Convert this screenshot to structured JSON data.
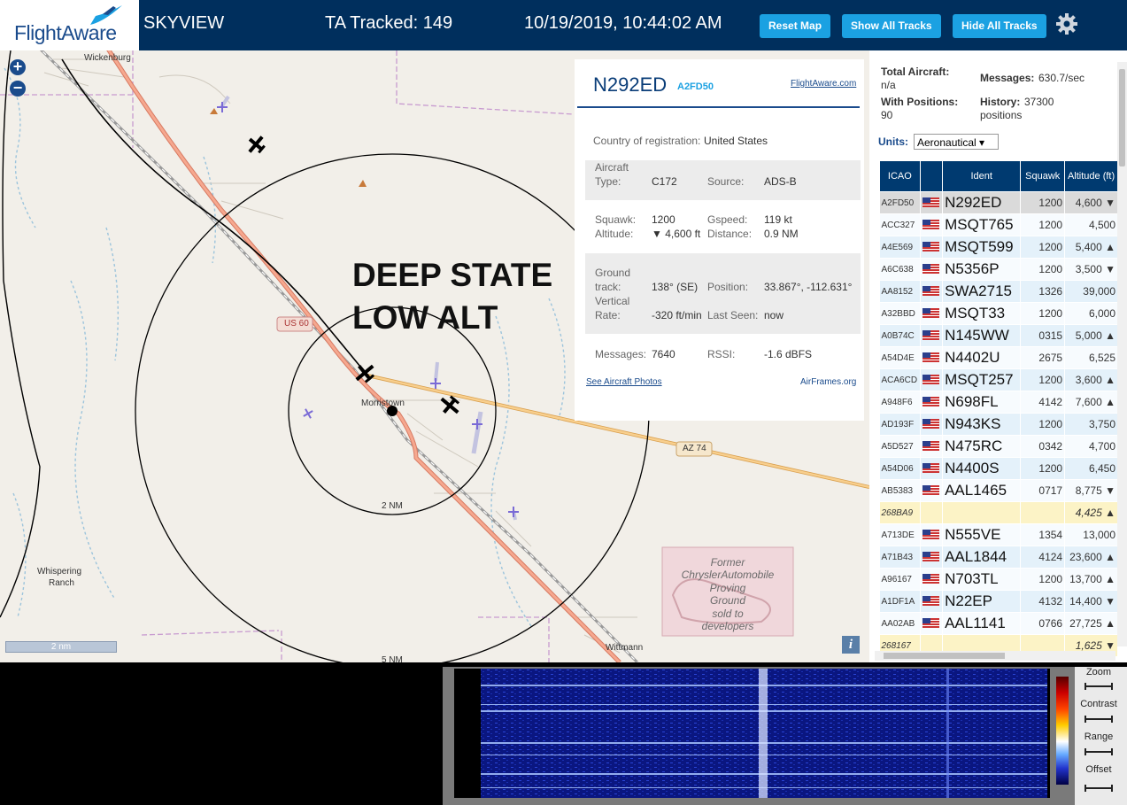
{
  "header": {
    "logo_text": "FlightAware",
    "title": "SKYVIEW",
    "tracked": "TA Tracked: 149",
    "datetime": "10/19/2019, 10:44:02 AM",
    "buttons": {
      "reset": "Reset Map",
      "show_all": "Show All Tracks",
      "hide_all": "Hide All Tracks"
    },
    "colors": {
      "bar": "#002f5d",
      "button": "#1ba1e2"
    }
  },
  "map": {
    "zoom_in": "+",
    "zoom_out": "−",
    "scale": "2 nm",
    "info": "i",
    "labels": {
      "wickenburg": "Wickenburg",
      "us60": "US 60",
      "az74": "AZ 74",
      "morristown": "Morristown",
      "ring_2nm": "2 NM",
      "ring_5nm": "5 NM",
      "whispering_1": "Whispering",
      "whispering_2": "Ranch",
      "wittmann": "Wittmann",
      "former": [
        "Former",
        "ChryslerAutomobile",
        "Proving",
        "Ground",
        "sold to",
        "developers"
      ]
    },
    "annotation": [
      "DEEP STATE",
      "LOW ALT"
    ]
  },
  "detail": {
    "callsign": "N292ED",
    "hex": "A2FD50",
    "fa_link": "FlightAware.com",
    "country_label": "Country of registration:",
    "country": "United States",
    "aircraft_type_label": [
      "Aircraft",
      "Type:"
    ],
    "aircraft_type": "C172",
    "source_label": "Source:",
    "source": "ADS-B",
    "squawk_label": "Squawk:",
    "squawk": "1200",
    "gspeed_label": "Gspeed:",
    "gspeed": "119 kt",
    "altitude_label": "Altitude:",
    "altitude": "▼ 4,600 ft",
    "distance_label": "Distance:",
    "distance": "0.9 NM",
    "ground_label": [
      "Ground",
      "track:"
    ],
    "ground": "138° (SE)",
    "position_label": "Position:",
    "position": "33.867°, -112.631°",
    "vrate_label": [
      "Vertical",
      "Rate:"
    ],
    "vrate": "-320 ft/min",
    "lastseen_label": "Last Seen:",
    "lastseen": "now",
    "messages_label": "Messages:",
    "messages": "7640",
    "rssi_label": "RSSI:",
    "rssi": "-1.6 dBFS",
    "photos_link": "See Aircraft Photos",
    "airframes_link": "AirFrames.org"
  },
  "stats": {
    "total_label": "Total Aircraft:",
    "total": "n/a",
    "messages_label": "Messages:",
    "messages": "630.7/sec",
    "positions_label": "With Positions:",
    "positions": "90",
    "history_label": "History:",
    "history": "37300",
    "history_unit": "positions",
    "units_label": "Units:",
    "units_value": "Aeronautical ▾"
  },
  "table": {
    "headers": [
      "ICAO",
      "",
      "Ident",
      "Squawk",
      "Altitude (ft)"
    ],
    "rows": [
      {
        "icao": "A2FD50",
        "ident": "N292ED",
        "squawk": "1200",
        "alt": "4,600 ▼",
        "sel": true
      },
      {
        "icao": "ACC327",
        "ident": "MSQT765",
        "squawk": "1200",
        "alt": "4,500"
      },
      {
        "icao": "A4E569",
        "ident": "MSQT599",
        "squawk": "1200",
        "alt": "5,400 ▲"
      },
      {
        "icao": "A6C638",
        "ident": "N5356P",
        "squawk": "1200",
        "alt": "3,500 ▼"
      },
      {
        "icao": "AA8152",
        "ident": "SWA2715",
        "squawk": "1326",
        "alt": "39,000"
      },
      {
        "icao": "A32BBD",
        "ident": "MSQT33",
        "squawk": "1200",
        "alt": "6,000"
      },
      {
        "icao": "A0B74C",
        "ident": "N145WW",
        "squawk": "0315",
        "alt": "5,000 ▲"
      },
      {
        "icao": "A54D4E",
        "ident": "N4402U",
        "squawk": "2675",
        "alt": "6,525"
      },
      {
        "icao": "ACA6CD",
        "ident": "MSQT257",
        "squawk": "1200",
        "alt": "3,600 ▲"
      },
      {
        "icao": "A948F6",
        "ident": "N698FL",
        "squawk": "4142",
        "alt": "7,600 ▲"
      },
      {
        "icao": "AD193F",
        "ident": "N943KS",
        "squawk": "1200",
        "alt": "3,750"
      },
      {
        "icao": "A5D527",
        "ident": "N475RC",
        "squawk": "0342",
        "alt": "4,700"
      },
      {
        "icao": "A54D06",
        "ident": "N4400S",
        "squawk": "1200",
        "alt": "6,450"
      },
      {
        "icao": "AB5383",
        "ident": "AAL1465",
        "squawk": "0717",
        "alt": "8,775 ▼"
      },
      {
        "icao": "268BA9",
        "ident": "",
        "squawk": "",
        "alt": "4,425 ▲",
        "nopos": true
      },
      {
        "icao": "A713DE",
        "ident": "N555VE",
        "squawk": "1354",
        "alt": "13,000"
      },
      {
        "icao": "A71B43",
        "ident": "AAL1844",
        "squawk": "4124",
        "alt": "23,600 ▲"
      },
      {
        "icao": "A96167",
        "ident": "N703TL",
        "squawk": "1200",
        "alt": "13,700 ▲"
      },
      {
        "icao": "A1DF1A",
        "ident": "N22EP",
        "squawk": "4132",
        "alt": "14,400 ▼"
      },
      {
        "icao": "AA02AB",
        "ident": "AAL1141",
        "squawk": "0766",
        "alt": "27,725 ▲"
      },
      {
        "icao": "268167",
        "ident": "",
        "squawk": "",
        "alt": "1,625 ▼",
        "nopos": true
      }
    ]
  },
  "waterfall": {
    "zoom_label": "Zoom",
    "contrast_label": "Contrast",
    "range_label": "Range",
    "offset_label": "Offset"
  }
}
